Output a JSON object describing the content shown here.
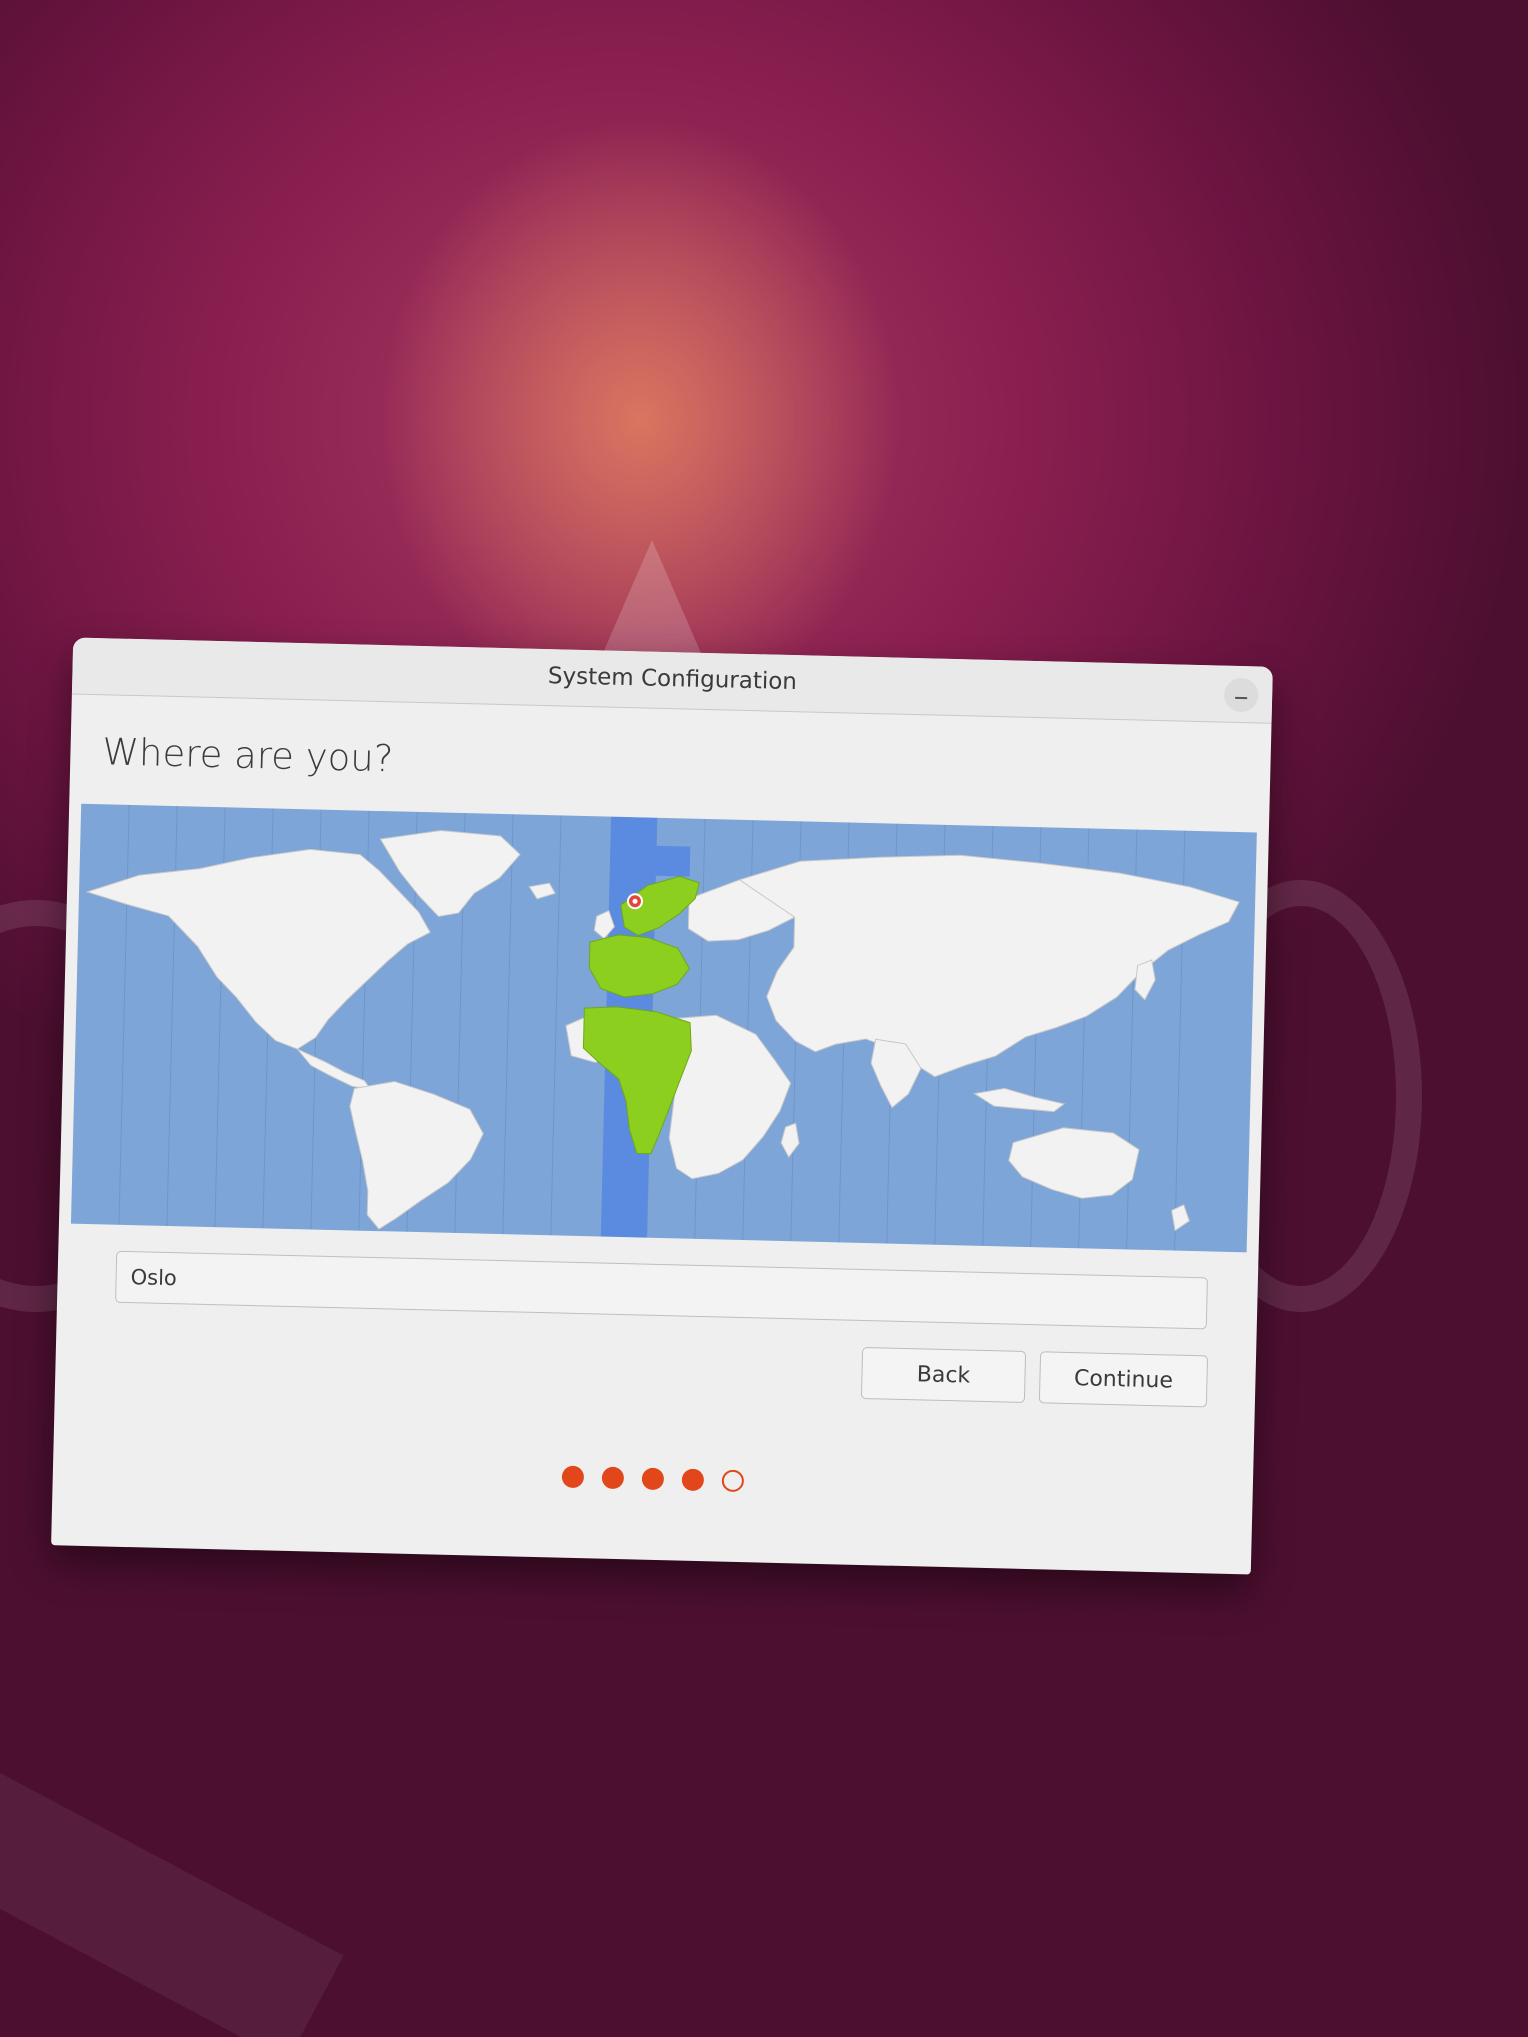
{
  "window": {
    "title": "System Configuration"
  },
  "page": {
    "heading": "Where are you?"
  },
  "map": {
    "selected_timezone_color": "#5b8be0",
    "highlight_color": "#8ccf1e",
    "ocean_color": "#7ea5d7",
    "land_color": "#f2f2f2",
    "marker_color": "#e2473a"
  },
  "location": {
    "value": "Oslo"
  },
  "buttons": {
    "back_label": "Back",
    "continue_label": "Continue"
  },
  "progress": {
    "total_steps": 5,
    "completed_steps": 4,
    "accent_color": "#e2471b"
  }
}
